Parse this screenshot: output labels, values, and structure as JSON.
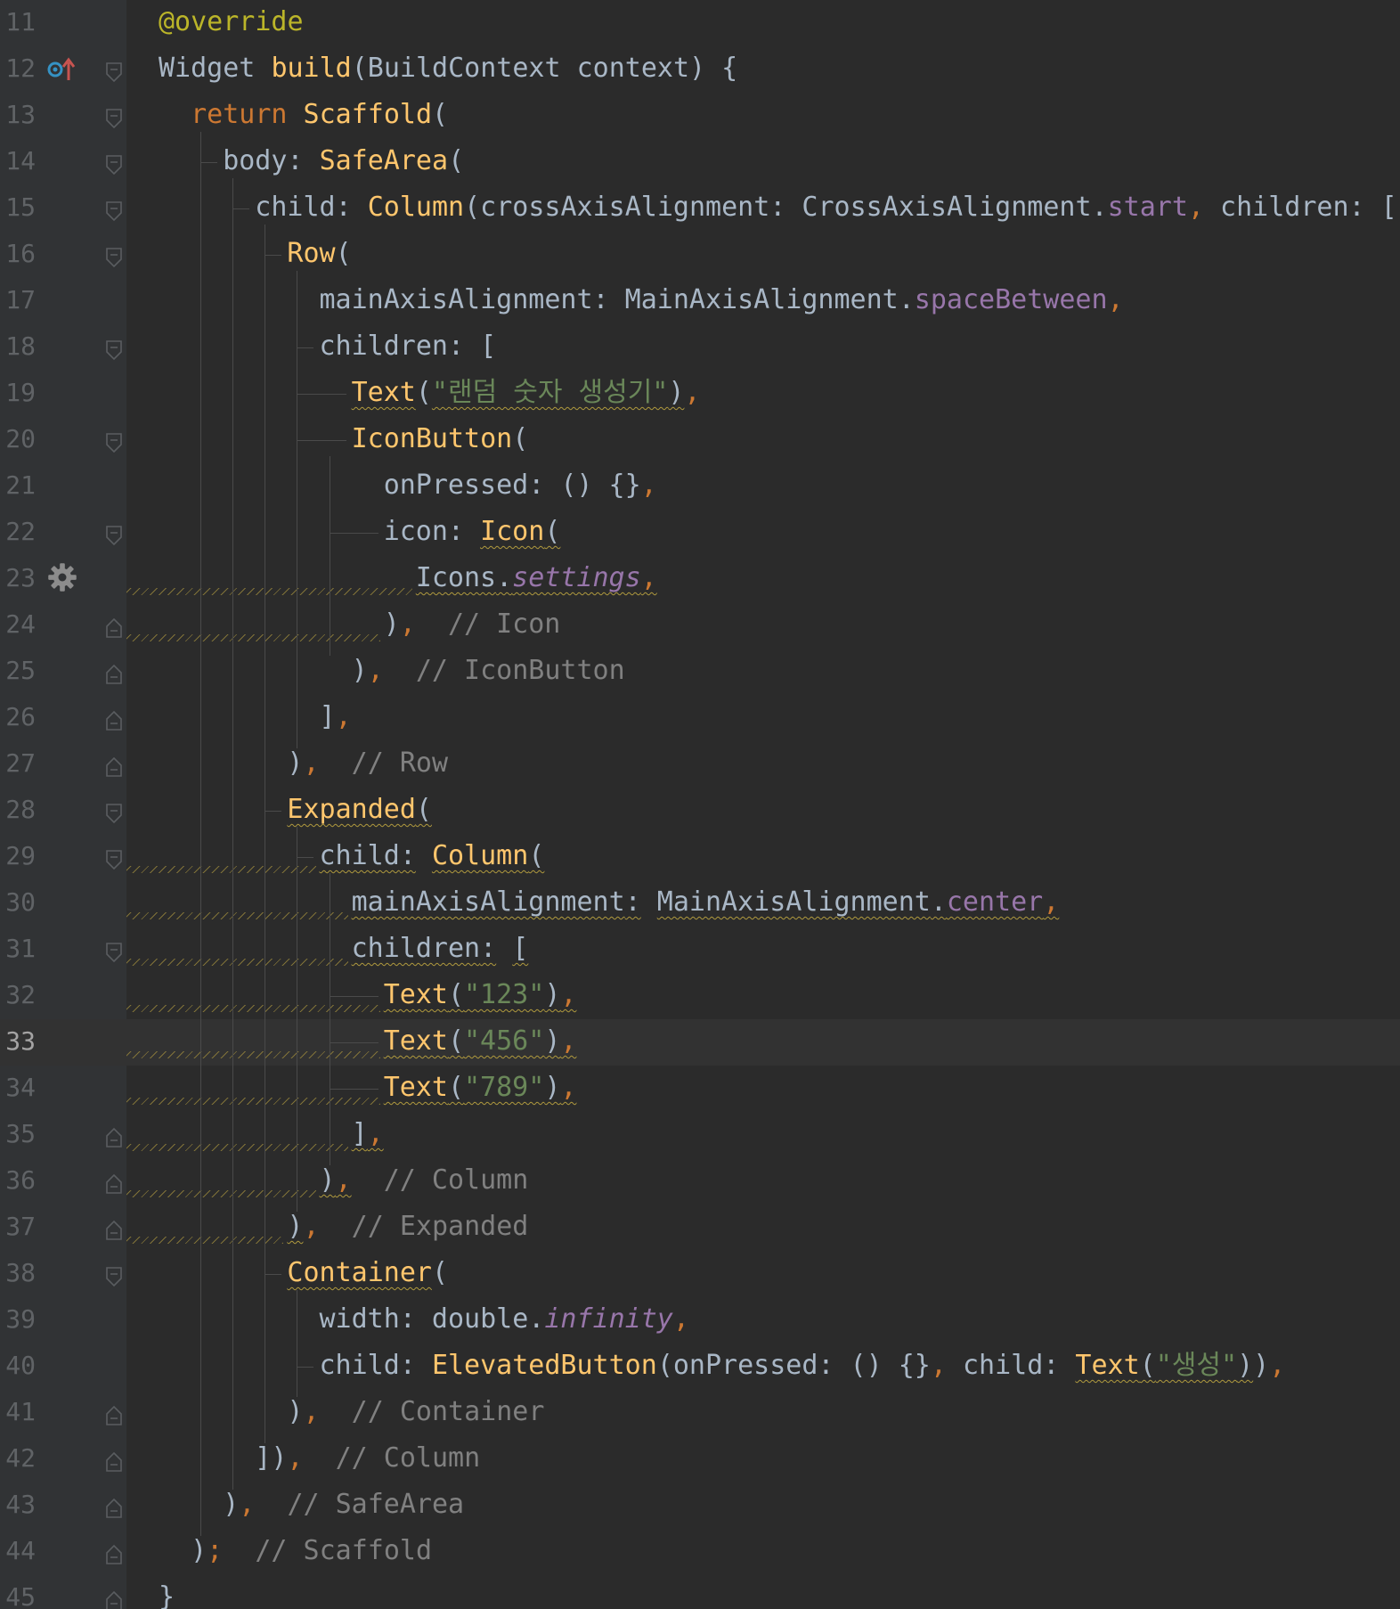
{
  "editor": {
    "current_line": 33,
    "lines": [
      {
        "n": "11",
        "text": "@override"
      },
      {
        "n": "12",
        "text": "Widget build(BuildContext context) {"
      },
      {
        "n": "13",
        "text": "return Scaffold("
      },
      {
        "n": "14",
        "text": "body: SafeArea("
      },
      {
        "n": "15",
        "text": "child: Column(crossAxisAlignment: CrossAxisAlignment.start, children: ["
      },
      {
        "n": "16",
        "text": "Row("
      },
      {
        "n": "17",
        "text": "mainAxisAlignment: MainAxisAlignment.spaceBetween,"
      },
      {
        "n": "18",
        "text": "children: ["
      },
      {
        "n": "19",
        "text": "Text(\"랜덤 숫자 생성기\"),"
      },
      {
        "n": "20",
        "text": "IconButton("
      },
      {
        "n": "21",
        "text": "onPressed: () {},"
      },
      {
        "n": "22",
        "text": "icon: Icon("
      },
      {
        "n": "23",
        "text": "Icons.settings,"
      },
      {
        "n": "24",
        "text": "),  // Icon"
      },
      {
        "n": "25",
        "text": "),  // IconButton"
      },
      {
        "n": "26",
        "text": "],"
      },
      {
        "n": "27",
        "text": "),  // Row"
      },
      {
        "n": "28",
        "text": "Expanded("
      },
      {
        "n": "29",
        "text": "child: Column("
      },
      {
        "n": "30",
        "text": "mainAxisAlignment: MainAxisAlignment.center,"
      },
      {
        "n": "31",
        "text": "children: ["
      },
      {
        "n": "32",
        "text": "Text(\"123\"),"
      },
      {
        "n": "33",
        "text": "Text(\"456\"),"
      },
      {
        "n": "34",
        "text": "Text(\"789\"),"
      },
      {
        "n": "35",
        "text": "],"
      },
      {
        "n": "36",
        "text": "),  // Column"
      },
      {
        "n": "37",
        "text": "),  // Expanded"
      },
      {
        "n": "38",
        "text": "Container("
      },
      {
        "n": "39",
        "text": "width: double.infinity,"
      },
      {
        "n": "40",
        "text": "child: ElevatedButton(onPressed: () {}, child: Text(\"생성\")),"
      },
      {
        "n": "41",
        "text": "),  // Container"
      },
      {
        "n": "42",
        "text": "]),  // Column"
      },
      {
        "n": "43",
        "text": "),  // SafeArea"
      },
      {
        "n": "44",
        "text": ");  // Scaffold"
      },
      {
        "n": "45",
        "text": "}"
      }
    ],
    "gutter_icons": {
      "line_12": "override-method-icon",
      "line_23": "settings-icon"
    }
  },
  "colors": {
    "background": "#2b2b2b",
    "gutter": "#313335",
    "keyword": "#cc7832",
    "function": "#ffc66d",
    "string": "#6a8759",
    "comment": "#808080",
    "field": "#9876aa",
    "annotation": "#bbb529",
    "text": "#a9b7c6"
  }
}
